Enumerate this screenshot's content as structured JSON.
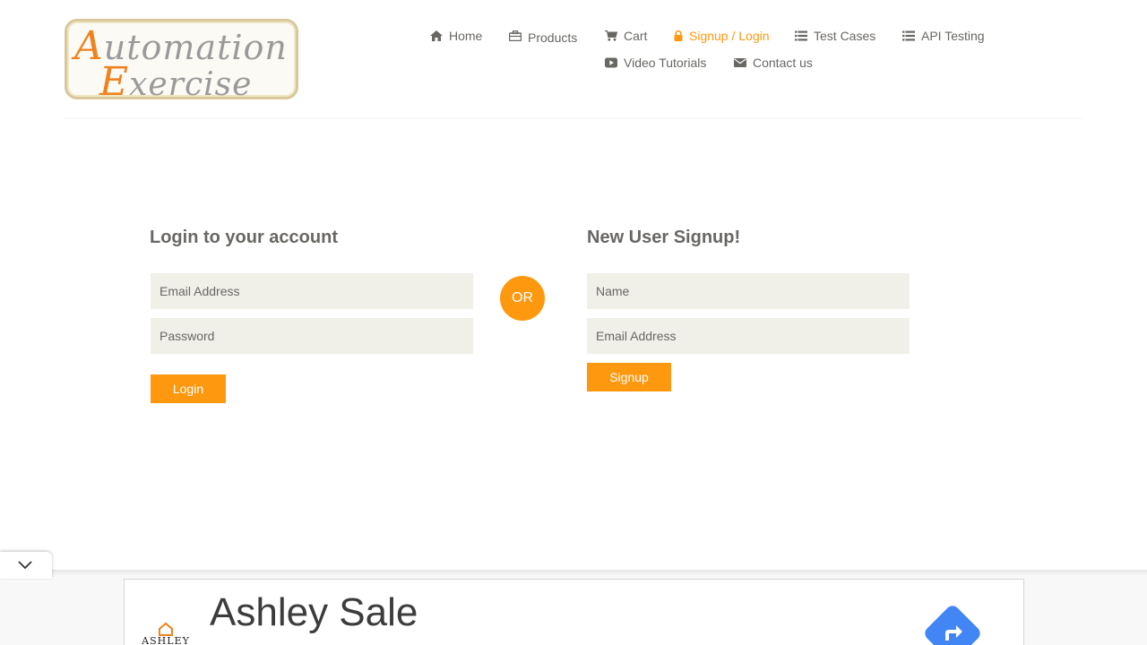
{
  "logo": {
    "line1_cap": "A",
    "line1_rest": "utomation",
    "line2_cap": "E",
    "line2_rest": "xercise"
  },
  "nav": {
    "items": [
      {
        "label": "Home",
        "icon": "home-icon"
      },
      {
        "label": "Products",
        "icon": "briefcase-icon"
      },
      {
        "label": "Cart",
        "icon": "cart-icon"
      },
      {
        "label": "Signup / Login",
        "icon": "lock-icon",
        "active": true
      },
      {
        "label": "Test Cases",
        "icon": "list-icon"
      },
      {
        "label": "API Testing",
        "icon": "list-icon"
      },
      {
        "label": "Video Tutorials",
        "icon": "youtube-play-icon"
      },
      {
        "label": "Contact us",
        "icon": "envelope-icon"
      }
    ]
  },
  "login": {
    "title": "Login to your account",
    "email_placeholder": "Email Address",
    "password_placeholder": "Password",
    "button_label": "Login"
  },
  "divider": {
    "label": "OR"
  },
  "signup": {
    "title": "New User Signup!",
    "name_placeholder": "Name",
    "email_placeholder": "Email Address",
    "button_label": "Signup"
  },
  "ad": {
    "title": "Ashley Sale",
    "brand": "ASHLEY"
  },
  "colors": {
    "accent": "#fe980f",
    "text": "#696763",
    "field_bg": "#f0f0e9"
  }
}
